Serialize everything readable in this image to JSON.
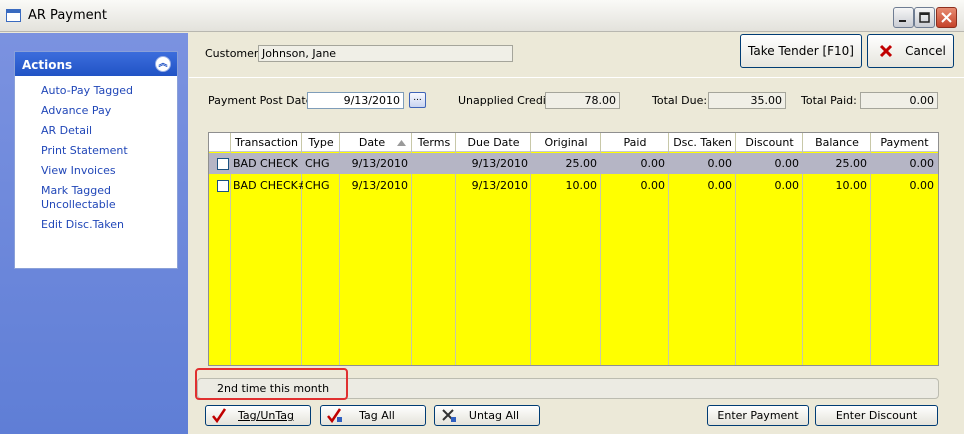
{
  "window": {
    "title": "AR Payment"
  },
  "actions": {
    "header": "Actions",
    "items": [
      "Auto-Pay Tagged",
      "Advance Pay",
      "AR Detail",
      "Print Statement",
      "View Invoices",
      "Mark Tagged Uncollectable",
      "Edit Disc.Taken"
    ]
  },
  "customer": {
    "label": "Customer:",
    "value": "Johnson, Jane"
  },
  "toolbar": {
    "take_tender_label": "Take Tender [F10]",
    "cancel_label": "Cancel"
  },
  "payment": {
    "post_date_label": "Payment Post Date:",
    "post_date_value": "9/13/2010",
    "browse_label": "...",
    "unapplied_credit_label": "Unapplied Credit:",
    "unapplied_credit_value": "78.00",
    "total_due_label": "Total Due:",
    "total_due_value": "35.00",
    "total_paid_label": "Total Paid:",
    "total_paid_value": "0.00"
  },
  "grid": {
    "columns": [
      "Transaction",
      "Type",
      "Date",
      "Terms",
      "Due Date",
      "Original",
      "Paid",
      "Dsc. Taken",
      "Discount",
      "Balance",
      "Payment"
    ],
    "rows": [
      {
        "transaction": "BAD CHECK",
        "type": "CHG",
        "date": "9/13/2010",
        "terms": "",
        "due_date": "9/13/2010",
        "original": "25.00",
        "paid": "0.00",
        "dsc_taken": "0.00",
        "discount": "0.00",
        "balance": "25.00",
        "payment": "0.00"
      },
      {
        "transaction": "BAD CHECK#",
        "type": "CHG",
        "date": "9/13/2010",
        "terms": "",
        "due_date": "9/13/2010",
        "original": "10.00",
        "paid": "0.00",
        "dsc_taken": "0.00",
        "discount": "0.00",
        "balance": "10.00",
        "payment": "0.00"
      }
    ]
  },
  "note": "2nd time this month",
  "bottom_buttons": {
    "tag_untag": "Tag/UnTag",
    "tag_all": "Tag All",
    "untag_all": "Untag All",
    "enter_payment": "Enter Payment",
    "enter_discount": "Enter Discount"
  },
  "colors": {
    "grid_background": "#ffff00",
    "selected_row": "#b5b5c5",
    "highlight_box": "#e03030",
    "actions_link": "#2147b8"
  }
}
